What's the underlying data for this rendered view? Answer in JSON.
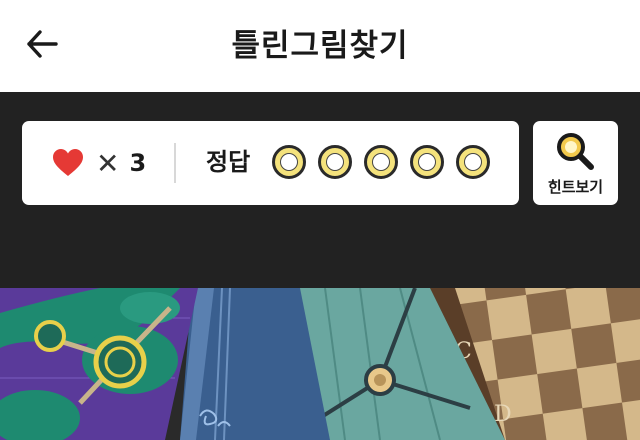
{
  "header": {
    "title": "틀린그림찾기",
    "back_icon": "back-arrow-icon"
  },
  "status": {
    "heart_icon": "heart-icon",
    "times_symbol": "✕",
    "lives_count": "3",
    "answer_label": "정답",
    "answer_slots": [
      {
        "found": false
      },
      {
        "found": false
      },
      {
        "found": false
      },
      {
        "found": false
      },
      {
        "found": false
      }
    ]
  },
  "hint": {
    "icon": "magnifier-icon",
    "label": "힌트보기"
  },
  "board": {
    "letters": [
      "C",
      "D"
    ]
  },
  "colors": {
    "background": "#222222",
    "heart": "#e53935",
    "slot_fill": "#f4e27c",
    "hint_lens": "#f2c94c"
  }
}
